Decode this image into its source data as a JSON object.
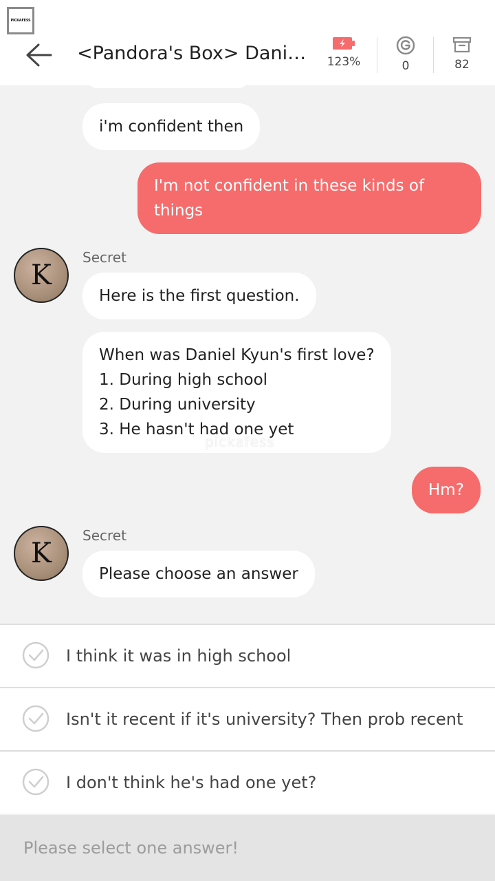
{
  "header": {
    "logo_text": "PICKAFESS",
    "title": "<Pandora's Box> Daniel...",
    "battery_value": "123%",
    "g_value": "0",
    "box_value": "82",
    "icons": {
      "back": "arrow-left-icon",
      "battery": "battery-icon",
      "coin": "g-coin-icon",
      "archive": "archive-box-icon"
    },
    "battery_color": "#f66b6b"
  },
  "messages": [
    {
      "sender": "",
      "side": "left",
      "text": "i'm confident then"
    },
    {
      "sender": "",
      "side": "right",
      "text": "I'm not confident in these kinds of things"
    },
    {
      "sender": "Secret",
      "side": "left",
      "avatar_letter": "K",
      "text": "Here is the first question."
    },
    {
      "sender": "",
      "side": "left",
      "lines": [
        "When was Daniel Kyun's first love?",
        "1. During high school",
        "2. During university",
        "3. He hasn't had one yet"
      ]
    },
    {
      "sender": "",
      "side": "right",
      "text": "Hm?"
    },
    {
      "sender": "Secret",
      "side": "left",
      "avatar_letter": "K",
      "text": "Please choose an answer"
    }
  ],
  "watermark": "pickafess",
  "options": [
    {
      "label": "I think it was in high school"
    },
    {
      "label": "Isn't it recent if it's university? Then prob recent"
    },
    {
      "label": "I don't think he's had one yet?"
    }
  ],
  "footer": {
    "text": "Please select one answer!"
  },
  "colors": {
    "accent": "#f66b6b",
    "background": "#f2f2f2",
    "bubble": "#ffffff"
  }
}
